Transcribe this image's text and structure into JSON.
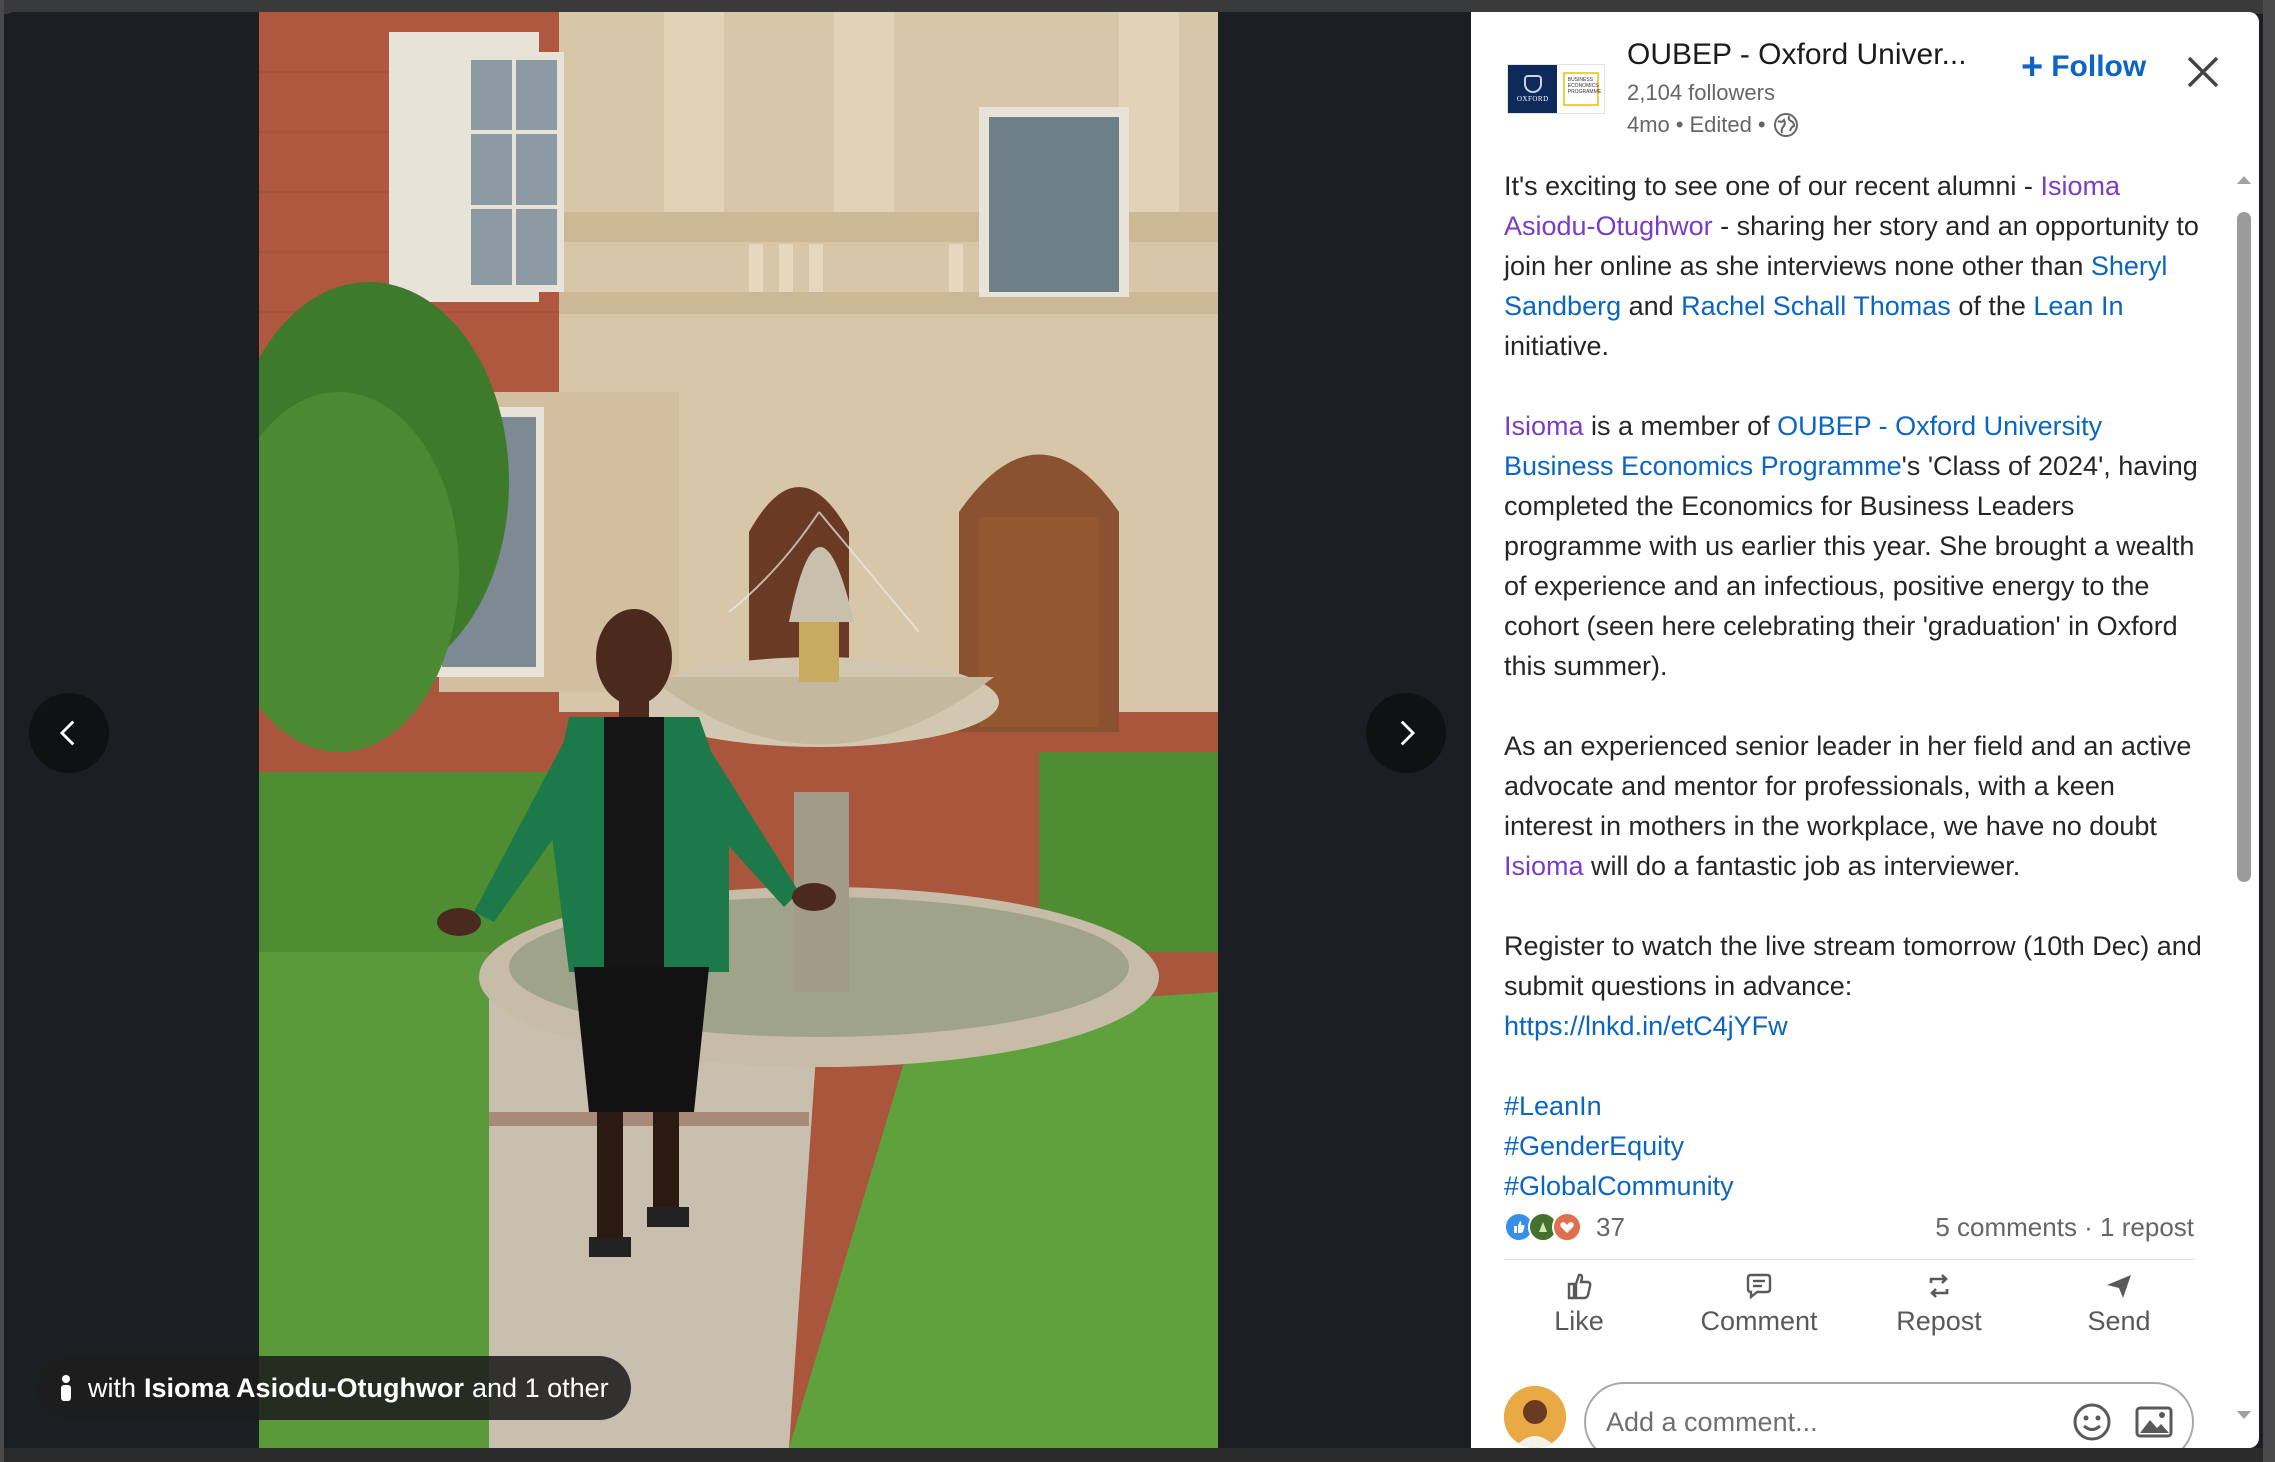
{
  "media": {
    "tag_prefix": "with",
    "tag_name": "Isioma Asiodu-Otughwor",
    "tag_suffix": "and 1 other"
  },
  "header": {
    "org_name": "OUBEP - Oxford Univer...",
    "followers": "2,104 followers",
    "age": "4mo",
    "edited": "Edited",
    "follow_label": "Follow",
    "logo_text": "OXFORD",
    "logo_sub": "BUSINESS ECONOMICS PROGRAMME"
  },
  "post": {
    "p1_a": "It's exciting to see one of our recent alumni - ",
    "p1_mention1": "Isioma Asiodu-Otughwor",
    "p1_b": " - sharing her story and an opportunity to join her online as she interviews none other than ",
    "p1_mention2": "Sheryl Sandberg",
    "p1_c": " and ",
    "p1_mention3": "Rachel Schall Thomas",
    "p1_d": " of the ",
    "p1_mention4": "Lean In",
    "p1_e": " initiative.",
    "p2_mention1": "Isioma",
    "p2_a": " is a member of ",
    "p2_mention2": "OUBEP - Oxford University Business Economics Programme",
    "p2_b": "'s 'Class of 2024', having completed the Economics for Business Leaders programme with us earlier this year. She brought a wealth of experience and an infectious, positive energy to the cohort (seen here celebrating their 'graduation' in Oxford this summer).",
    "p3_a": "As an experienced senior leader in her field and an active advocate and mentor for professionals, with a keen interest in mothers in the workplace, we have no doubt ",
    "p3_mention": "Isioma",
    "p3_b": " will do a fantastic job as interviewer.",
    "p4_a": "Register to watch the live stream tomorrow (10th Dec) and submit questions in advance:",
    "p4_link": "https://lnkd.in/etC4jYFw",
    "hashtags": [
      "#LeanIn",
      "#GenderEquity",
      "#GlobalCommunity"
    ]
  },
  "social": {
    "reaction_count": "37",
    "comments_repost": "5 comments · 1 repost"
  },
  "actions": {
    "like": "Like",
    "comment": "Comment",
    "repost": "Repost",
    "send": "Send"
  },
  "composer": {
    "placeholder": "Add a comment..."
  },
  "colors": {
    "accent_blue": "#0a66c2",
    "mention_purple": "#7a3cc9",
    "panel_bg": "#ffffff",
    "media_bg": "#1b1f23"
  }
}
